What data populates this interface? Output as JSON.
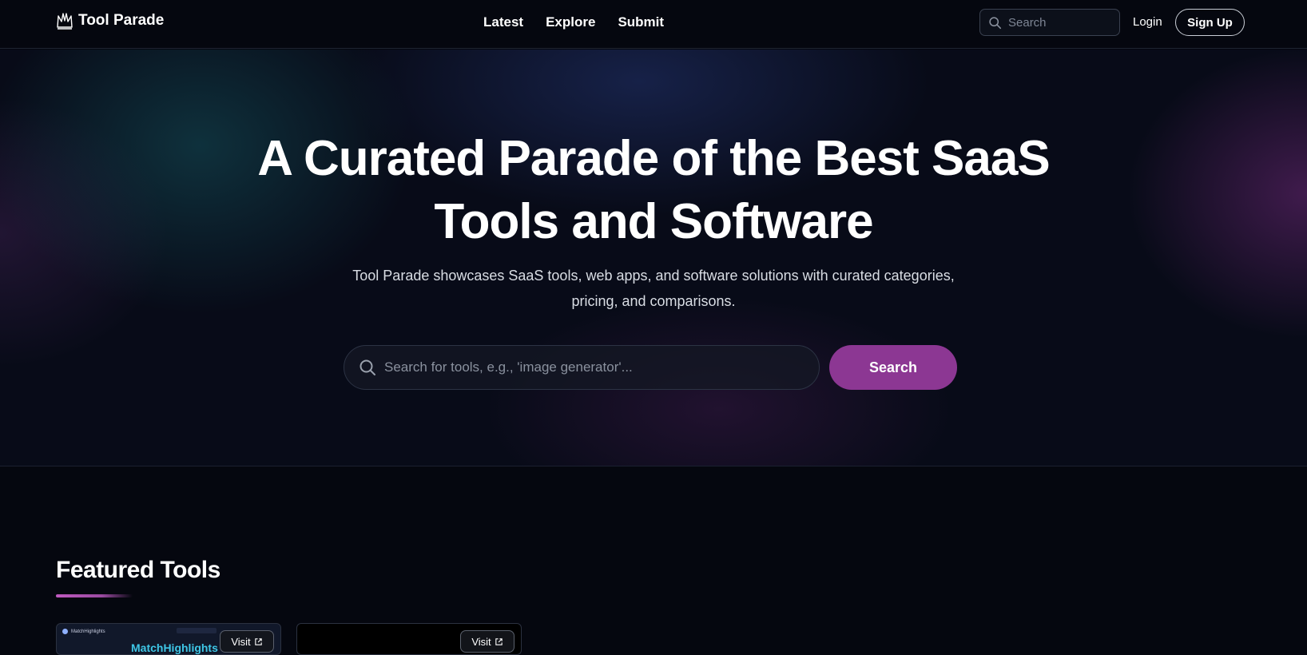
{
  "header": {
    "logo_text": "Tool Parade",
    "nav": [
      {
        "label": "Latest"
      },
      {
        "label": "Explore"
      },
      {
        "label": "Submit"
      }
    ],
    "search_placeholder": "Search",
    "login_label": "Login",
    "signup_label": "Sign Up"
  },
  "hero": {
    "title": "A Curated Parade of the Best SaaS Tools and Software",
    "subtitle": "Tool Parade showcases SaaS tools, web apps, and software solutions with curated categories, pricing, and comparisons.",
    "search_placeholder": "Search for tools, e.g., 'image generator'...",
    "search_button": "Search"
  },
  "featured": {
    "title": "Featured Tools",
    "cards": [
      {
        "brand": "MatchHighlights",
        "headline": "MatchHighlights",
        "visit_label": "Visit"
      },
      {
        "visit_label": "Visit"
      }
    ]
  },
  "colors": {
    "accent": "#8c3793",
    "background": "#05070f"
  },
  "icons": {
    "logo": "crown-icon",
    "search": "search-icon",
    "external": "external-link-icon"
  }
}
